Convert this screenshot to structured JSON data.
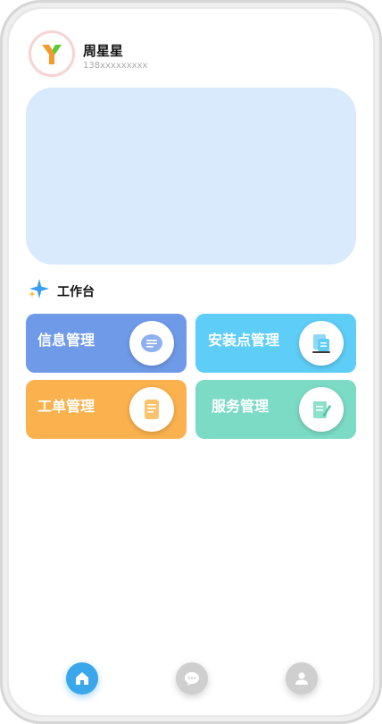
{
  "user": {
    "name": "周星星",
    "phone": "138xxxxxxxxx"
  },
  "section": {
    "title": "工作台",
    "icon": "sparkle-icon"
  },
  "cards": [
    {
      "label": "信息管理",
      "color": "#6f9ae8",
      "icon": "message-list-icon"
    },
    {
      "label": "安装点管理",
      "color": "#5ecdf7",
      "icon": "install-point-icon"
    },
    {
      "label": "工单管理",
      "color": "#fbb14d",
      "icon": "work-order-icon"
    },
    {
      "label": "服务管理",
      "color": "#7cdbc4",
      "icon": "service-edit-icon"
    }
  ],
  "tabbar": [
    {
      "name": "home",
      "icon": "home-icon",
      "active": true,
      "color": "#3aa7ea"
    },
    {
      "name": "messages",
      "icon": "chat-icon",
      "active": false,
      "color": "#cfcfcf"
    },
    {
      "name": "profile",
      "icon": "user-icon",
      "active": false,
      "color": "#cfcfcf"
    }
  ],
  "colors": {
    "banner": "#d8eafb",
    "logo_orange": "#f39c2b",
    "logo_green": "#5cc93a"
  }
}
